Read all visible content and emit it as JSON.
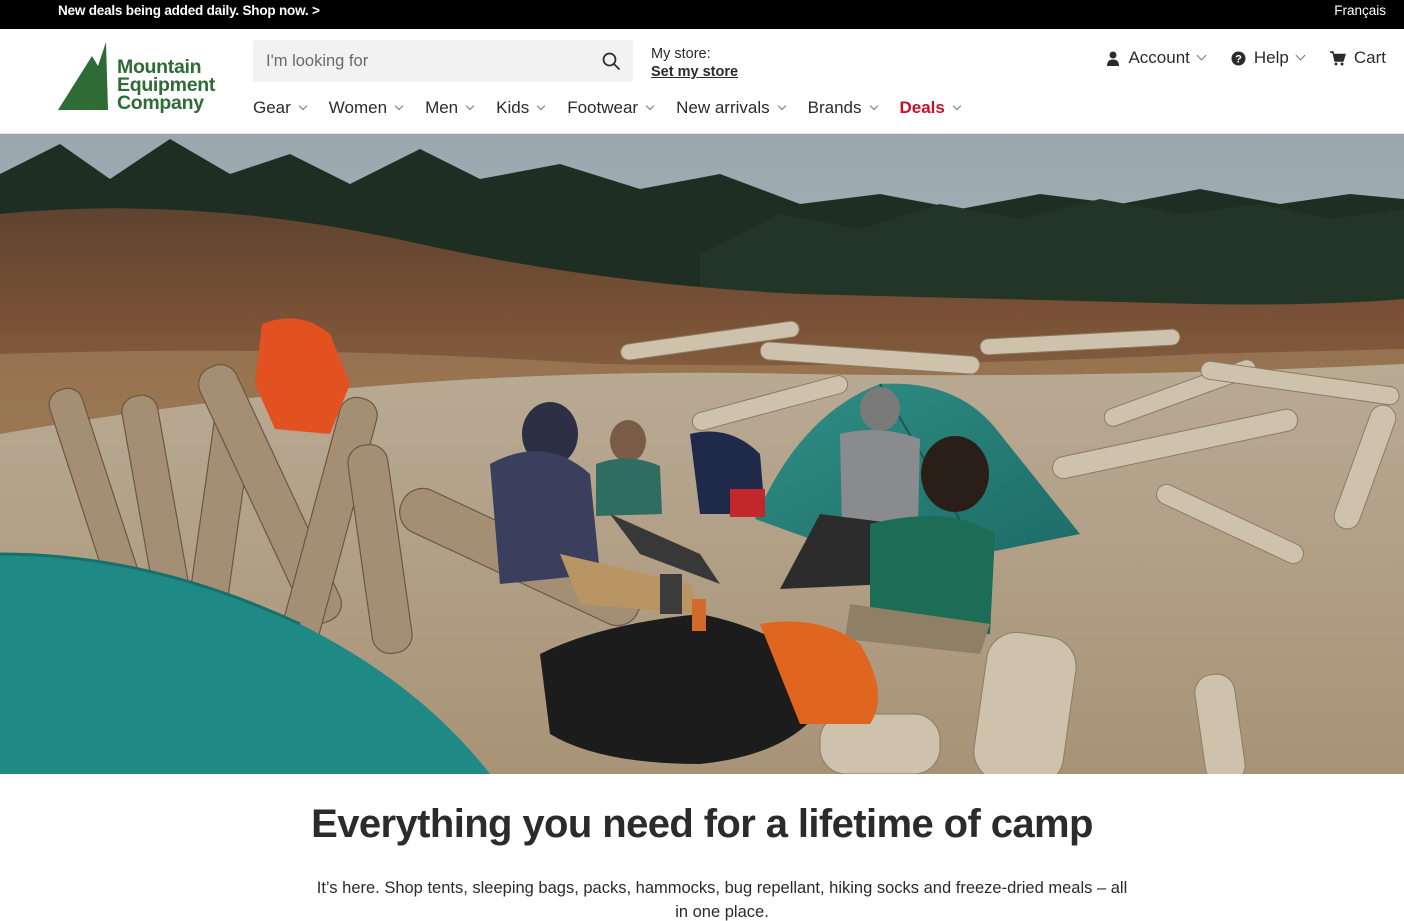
{
  "promo": {
    "text": "New deals being added daily. Shop now. >",
    "language": "Français"
  },
  "logo": {
    "line1": "Mountain",
    "line2": "Equipment",
    "line3": "Company"
  },
  "search": {
    "placeholder": "I'm looking for"
  },
  "store": {
    "label": "My store:",
    "link": "Set my store"
  },
  "utilities": {
    "account": "Account",
    "help": "Help",
    "cart": "Cart"
  },
  "nav": {
    "items": [
      "Gear",
      "Women",
      "Men",
      "Kids",
      "Footwear",
      "New arrivals",
      "Brands",
      "Deals"
    ]
  },
  "hero": {
    "headline": "Everything you need for a lifetime of camp",
    "body": "It’s here. Shop tents, sleeping bags, packs, hammocks, bug repellant, hiking socks and freeze-dried meals – all in one place."
  },
  "colors": {
    "brand_green": "#2e6b35",
    "deals_red": "#c8102e",
    "promo_bg": "#000000"
  }
}
